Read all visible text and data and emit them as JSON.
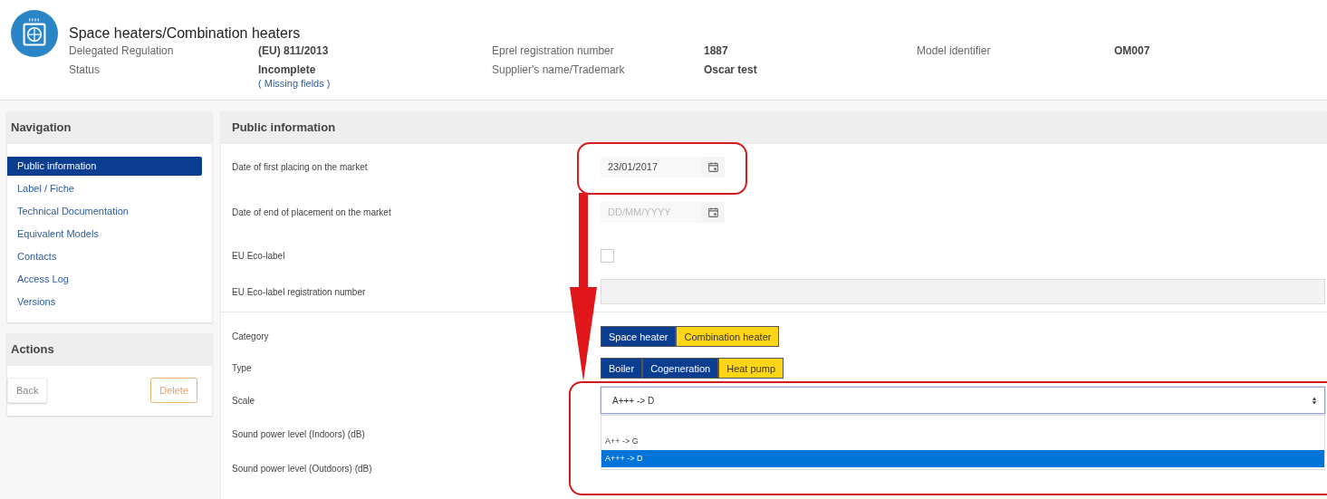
{
  "header": {
    "title": "Space heaters/Combination heaters",
    "fields": [
      {
        "label": "Delegated Regulation",
        "value": "(EU) 811/2013"
      },
      {
        "label": "Eprel registration number",
        "value": "1887"
      },
      {
        "label": "Model identifier",
        "value": "OM007"
      },
      {
        "label": "Status",
        "value": "Incomplete",
        "note": "( Missing fields )"
      },
      {
        "label": "Supplier's name/Trademark",
        "value": "Oscar test"
      }
    ]
  },
  "navigation": {
    "title": "Navigation",
    "items": [
      {
        "label": "Public information",
        "selected": true
      },
      {
        "label": "Label / Fiche",
        "selected": false
      },
      {
        "label": "Technical Documentation",
        "selected": false
      },
      {
        "label": "Equivalent Models",
        "selected": false
      },
      {
        "label": "Contacts",
        "selected": false
      },
      {
        "label": "Access Log",
        "selected": false
      },
      {
        "label": "Versions",
        "selected": false
      }
    ]
  },
  "actions": {
    "title": "Actions",
    "buttons": [
      {
        "label": "Back",
        "kind": "plain"
      },
      {
        "label": "Delete",
        "kind": "danger"
      }
    ]
  },
  "form": {
    "title": "Public information",
    "rows": [
      {
        "kind": "date",
        "label": "Date of first placing on the market",
        "value": "23/01/2017"
      },
      {
        "kind": "date",
        "label": "Date of end of placement on the market",
        "placeholder": "DD/MM/YYYY"
      },
      {
        "kind": "checkbox",
        "label": "EU Eco-label",
        "checked": false
      },
      {
        "kind": "text",
        "label": "EU Eco-label registration number",
        "disabled": true
      },
      {
        "kind": "divider"
      },
      {
        "kind": "segmented",
        "label": "Category",
        "options": [
          {
            "label": "Space heater",
            "selected": false
          },
          {
            "label": "Combination heater",
            "selected": true
          }
        ]
      },
      {
        "kind": "segmented",
        "label": "Type",
        "options": [
          {
            "label": "Boiler",
            "selected": false
          },
          {
            "label": "Cogeneration",
            "selected": false
          },
          {
            "label": "Heat pump",
            "selected": true
          }
        ]
      },
      {
        "kind": "select",
        "label": "Scale",
        "value": "A+++ -> D",
        "expanded": true,
        "options": [
          {
            "label": "A++ -> G",
            "selected": false
          },
          {
            "label": "A+++ -> D",
            "selected": true
          }
        ]
      },
      {
        "kind": "plain",
        "label": "Sound power level (Indoors) (dB)"
      },
      {
        "kind": "plain",
        "label": "Sound power level (Outdoors) (dB)"
      }
    ]
  },
  "annotations": [
    {
      "kind": "box"
    },
    {
      "kind": "arrow"
    },
    {
      "kind": "box"
    }
  ]
}
